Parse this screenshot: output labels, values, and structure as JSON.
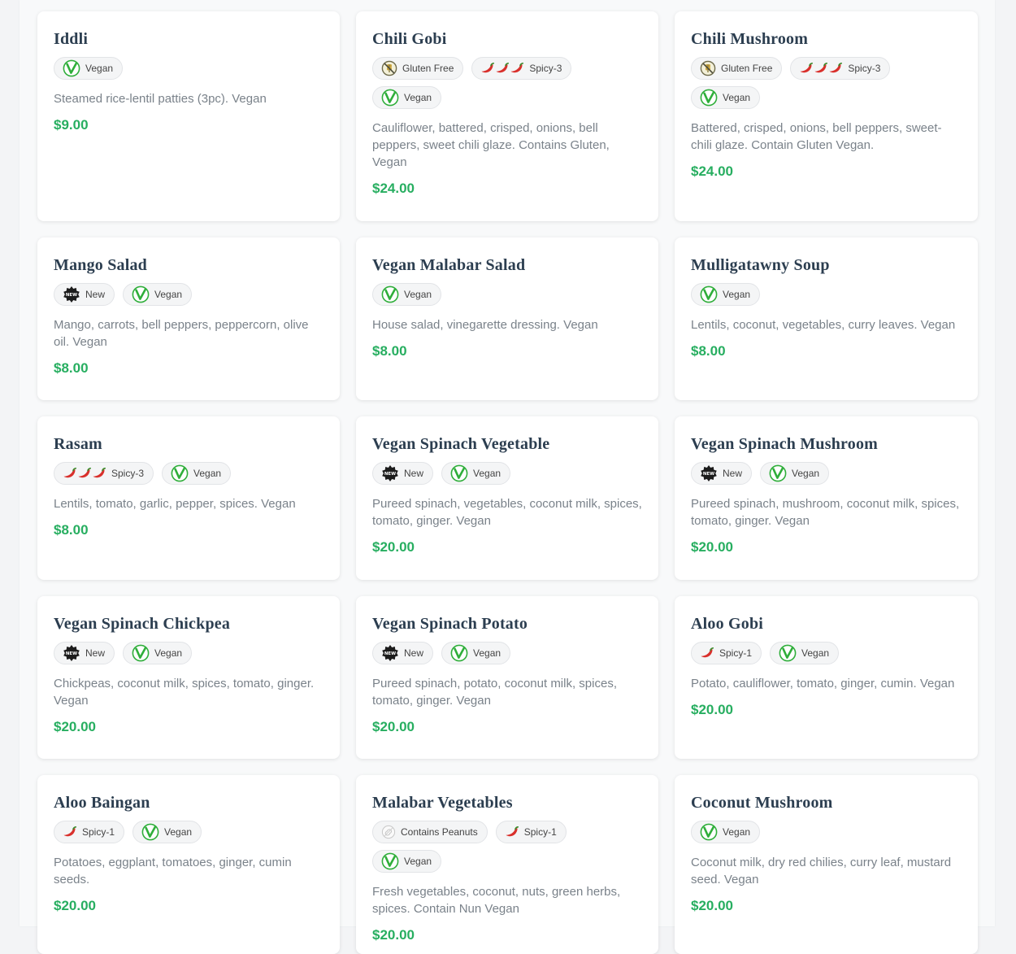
{
  "tag_labels": {
    "vegan": "Vegan",
    "gluten_free": "Gluten Free",
    "spicy3": "Spicy-3",
    "spicy1": "Spicy-1",
    "new": "New",
    "peanuts": "Contains Peanuts"
  },
  "tag_icons": {
    "vegan": "vegan-icon",
    "gluten_free": "gluten-free-icon",
    "spicy3": "chili-pepper-icon",
    "spicy1": "chili-pepper-icon",
    "new": "new-badge-icon",
    "peanuts": "peanut-icon"
  },
  "colors": {
    "price": "#27ae60",
    "title": "#2c3e50",
    "vegan_green": "#2fae3a",
    "chili_red": "#d9302c"
  },
  "items": [
    {
      "name": "Iddli",
      "tags": [
        "vegan"
      ],
      "description": "Steamed rice-lentil patties (3pc). Vegan",
      "price": "$9.00"
    },
    {
      "name": "Chili Gobi",
      "tags": [
        "gluten_free",
        "spicy3",
        "vegan"
      ],
      "description": "Cauliflower, battered, crisped, onions, bell peppers, sweet chili glaze. Contains Gluten, Vegan",
      "price": "$24.00"
    },
    {
      "name": "Chili Mushroom",
      "tags": [
        "gluten_free",
        "spicy3",
        "vegan"
      ],
      "description": "Battered, crisped, onions, bell peppers, sweet-chili glaze. Contain Gluten Vegan.",
      "price": "$24.00"
    },
    {
      "name": "Mango Salad",
      "tags": [
        "new",
        "vegan"
      ],
      "description": "Mango, carrots, bell peppers, peppercorn, olive oil. Vegan",
      "price": "$8.00"
    },
    {
      "name": "Vegan Malabar Salad",
      "tags": [
        "vegan"
      ],
      "description": "House salad, vinegarette dressing. Vegan",
      "price": "$8.00"
    },
    {
      "name": "Mulligatawny Soup",
      "tags": [
        "vegan"
      ],
      "description": "Lentils, coconut, vegetables, curry leaves. Vegan",
      "price": "$8.00"
    },
    {
      "name": "Rasam",
      "tags": [
        "spicy3",
        "vegan"
      ],
      "description": "Lentils, tomato, garlic, pepper, spices. Vegan",
      "price": "$8.00"
    },
    {
      "name": "Vegan Spinach Vegetable",
      "tags": [
        "new",
        "vegan"
      ],
      "description": "Pureed spinach, vegetables, coconut milk, spices, tomato, ginger. Vegan",
      "price": "$20.00"
    },
    {
      "name": "Vegan Spinach Mushroom",
      "tags": [
        "new",
        "vegan"
      ],
      "description": "Pureed spinach, mushroom, coconut milk, spices, tomato, ginger. Vegan",
      "price": "$20.00"
    },
    {
      "name": "Vegan Spinach Chickpea",
      "tags": [
        "new",
        "vegan"
      ],
      "description": "Chickpeas, coconut milk, spices, tomato, ginger. Vegan",
      "price": "$20.00"
    },
    {
      "name": "Vegan Spinach Potato",
      "tags": [
        "new",
        "vegan"
      ],
      "description": "Pureed spinach, potato, coconut milk, spices, tomato, ginger. Vegan",
      "price": "$20.00"
    },
    {
      "name": "Aloo Gobi",
      "tags": [
        "spicy1",
        "vegan"
      ],
      "description": "Potato, cauliflower, tomato, ginger, cumin. Vegan",
      "price": "$20.00"
    },
    {
      "name": "Aloo Baingan",
      "tags": [
        "spicy1",
        "vegan"
      ],
      "description": "Potatoes, eggplant, tomatoes, ginger, cumin seeds.",
      "price": "$20.00"
    },
    {
      "name": "Malabar Vegetables",
      "tags": [
        "peanuts",
        "spicy1",
        "vegan"
      ],
      "description": "Fresh vegetables, coconut, nuts, green herbs, spices. Contain Nun Vegan",
      "price": "$20.00"
    },
    {
      "name": "Coconut Mushroom",
      "tags": [
        "vegan"
      ],
      "description": "Coconut milk, dry red chilies, curry leaf, mustard seed. Vegan",
      "price": "$20.00"
    }
  ]
}
